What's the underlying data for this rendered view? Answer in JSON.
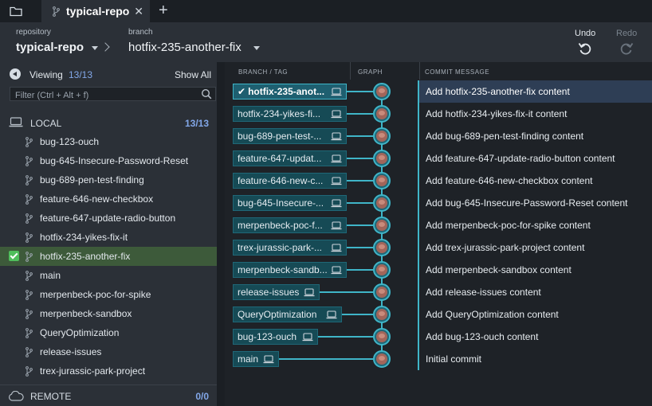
{
  "tabbar": {
    "tab_title": "typical-repo",
    "close_glyph": "✕",
    "add_glyph": "+"
  },
  "toolbar": {
    "repository_label": "repository",
    "repository_value": "typical-repo",
    "branch_label": "branch",
    "branch_value": "hotfix-235-another-fix",
    "undo_label": "Undo",
    "redo_label": "Redo"
  },
  "left_panel": {
    "viewing_label": "Viewing",
    "viewing_count": "13/13",
    "show_all": "Show All",
    "filter_placeholder": "Filter (Ctrl + Alt + f)",
    "local_label": "LOCAL",
    "local_count": "13/13",
    "remote_label": "REMOTE",
    "remote_count": "0/0",
    "branches": [
      {
        "name": "bug-123-ouch",
        "active": false
      },
      {
        "name": "bug-645-Insecure-Password-Reset",
        "active": false
      },
      {
        "name": "bug-689-pen-test-finding",
        "active": false
      },
      {
        "name": "feature-646-new-checkbox",
        "active": false
      },
      {
        "name": "feature-647-update-radio-button",
        "active": false
      },
      {
        "name": "hotfix-234-yikes-fix-it",
        "active": false
      },
      {
        "name": "hotfix-235-another-fix",
        "active": true
      },
      {
        "name": "main",
        "active": false
      },
      {
        "name": "merpenbeck-poc-for-spike",
        "active": false
      },
      {
        "name": "merpenbeck-sandbox",
        "active": false
      },
      {
        "name": "QueryOptimization",
        "active": false
      },
      {
        "name": "release-issues",
        "active": false
      },
      {
        "name": "trex-jurassic-park-project",
        "active": false
      }
    ]
  },
  "graph": {
    "columns": {
      "branch_tag": "BRANCH / TAG",
      "graph": "GRAPH",
      "commit_message": "COMMIT MESSAGE"
    },
    "rows": [
      {
        "ref": "hotfix-235-anot...",
        "message": "Add hotfix-235-another-fix content",
        "selected": true,
        "checked": true
      },
      {
        "ref": "hotfix-234-yikes-fi...",
        "message": "Add hotfix-234-yikes-fix-it content",
        "selected": false,
        "checked": false
      },
      {
        "ref": "bug-689-pen-test-...",
        "message": "Add bug-689-pen-test-finding content",
        "selected": false,
        "checked": false
      },
      {
        "ref": "feature-647-updat...",
        "message": "Add feature-647-update-radio-button content",
        "selected": false,
        "checked": false
      },
      {
        "ref": "feature-646-new-c...",
        "message": "Add feature-646-new-checkbox content",
        "selected": false,
        "checked": false
      },
      {
        "ref": "bug-645-Insecure-...",
        "message": "Add bug-645-Insecure-Password-Reset content",
        "selected": false,
        "checked": false
      },
      {
        "ref": "merpenbeck-poc-f...",
        "message": "Add merpenbeck-poc-for-spike content",
        "selected": false,
        "checked": false
      },
      {
        "ref": "trex-jurassic-park-...",
        "message": "Add trex-jurassic-park-project content",
        "selected": false,
        "checked": false
      },
      {
        "ref": "merpenbeck-sandb...",
        "message": "Add merpenbeck-sandbox content",
        "selected": false,
        "checked": false
      },
      {
        "ref": "release-issues",
        "message": "Add release-issues content",
        "selected": false,
        "checked": false
      },
      {
        "ref": "QueryOptimization",
        "message": "Add QueryOptimization content",
        "selected": false,
        "checked": false
      },
      {
        "ref": "bug-123-ouch",
        "message": "Add bug-123-ouch content",
        "selected": false,
        "checked": false
      },
      {
        "ref": "main",
        "message": "Initial commit",
        "selected": false,
        "checked": false
      }
    ]
  },
  "colors": {
    "accent_teal": "#3fb5c8",
    "count_blue": "#82a7e8",
    "active_green": "#4fbe5c"
  },
  "icons": [
    "folder-icon",
    "branch-icon",
    "close-icon",
    "plus-icon",
    "chevron-down-icon",
    "chevron-right-icon",
    "undo-icon",
    "redo-icon",
    "back-arrow-icon",
    "search-icon",
    "laptop-icon",
    "cloud-icon",
    "checkmark-icon",
    "avatar-icon"
  ]
}
